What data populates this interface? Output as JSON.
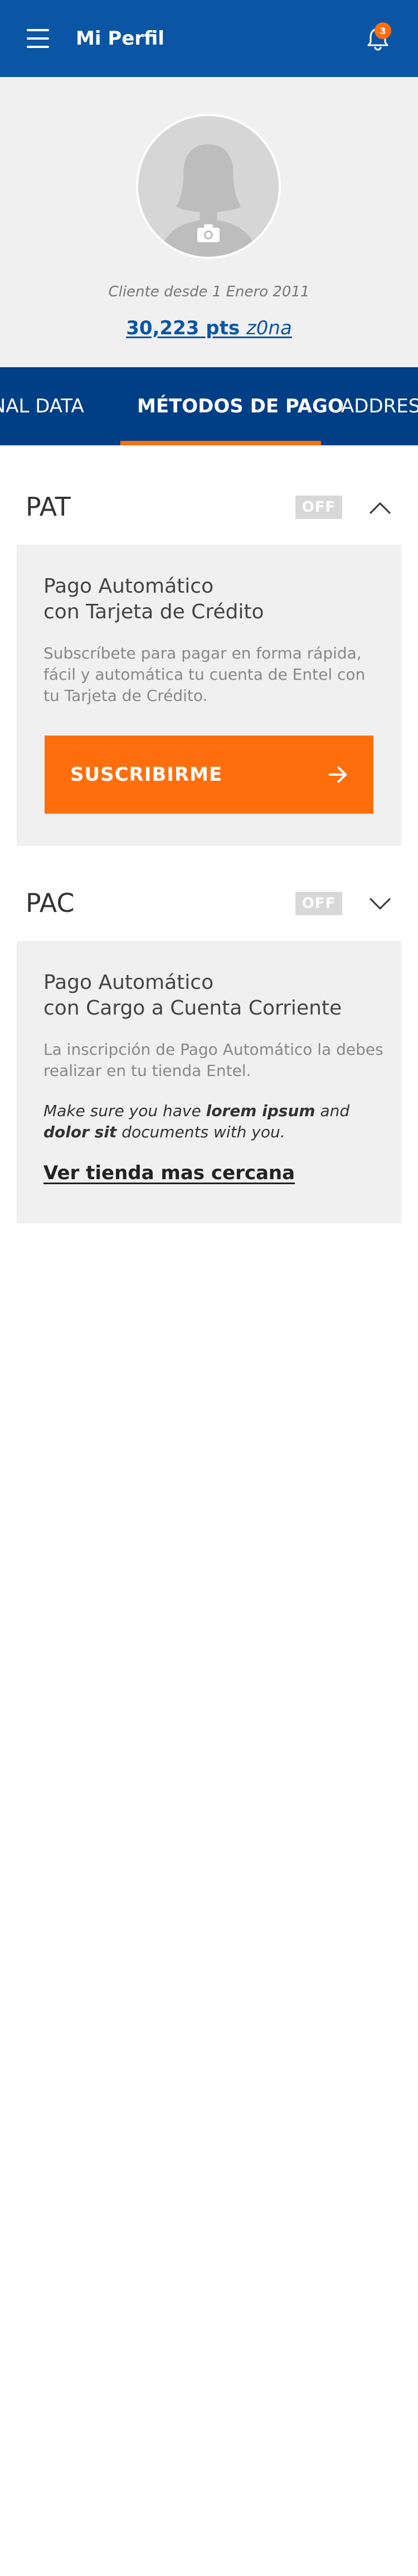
{
  "header": {
    "title": "Mi Perfil",
    "menu_icon": "hamburger-menu-icon",
    "notification_icon": "bell-icon",
    "notification_count": "3",
    "background": "#0B55A5"
  },
  "profile": {
    "avatar_icon": "user-avatar-placeholder",
    "camera_icon": "camera-icon",
    "client_since": "Cliente desde 1 Enero 2011",
    "points": "30,223 pts",
    "points_brand": "z0na"
  },
  "tabs": {
    "items": [
      {
        "label": "ONAL DATA"
      },
      {
        "label": "MÉTODOS DE PAGO"
      },
      {
        "label": "ADDRESS"
      }
    ],
    "active_index": 1,
    "indicator_color": "#FF6E0D",
    "background": "#003E86"
  },
  "pat": {
    "title": "PAT",
    "toggle": "OFF",
    "chevron_icon": "chevron-up-icon",
    "card": {
      "title_line1": "Pago Automático",
      "title_line2": "con Tarjeta de Crédito",
      "description": "Subscríbete para pagar en forma rápida, fácil y automática tu cuenta de Entel con tu Tarjeta de Crédito.",
      "button_label": "SUSCRIBIRME",
      "button_icon": "arrow-right-icon"
    }
  },
  "pac": {
    "title": "PAC",
    "toggle": "OFF",
    "chevron_icon": "chevron-down-icon",
    "card": {
      "title_line1": "Pago Automático",
      "title_line2": "con Cargo a Cuenta Corriente",
      "description": "La inscripción de Pago Automático la debes realizar en tu tienda Entel.",
      "note_prefix": "Make sure you have ",
      "note_bold1": "lorem ipsum",
      "note_mid": " and ",
      "note_bold2": "dolor sit",
      "note_suffix": " documents with you.",
      "link_label": "Ver tienda mas cercana"
    }
  },
  "colors": {
    "accent": "#FF6E0D",
    "brand_blue": "#0B55A5",
    "dark_blue": "#003E86",
    "card_bg": "#F0F0F0",
    "toggle_off": "#D8D8D8"
  }
}
